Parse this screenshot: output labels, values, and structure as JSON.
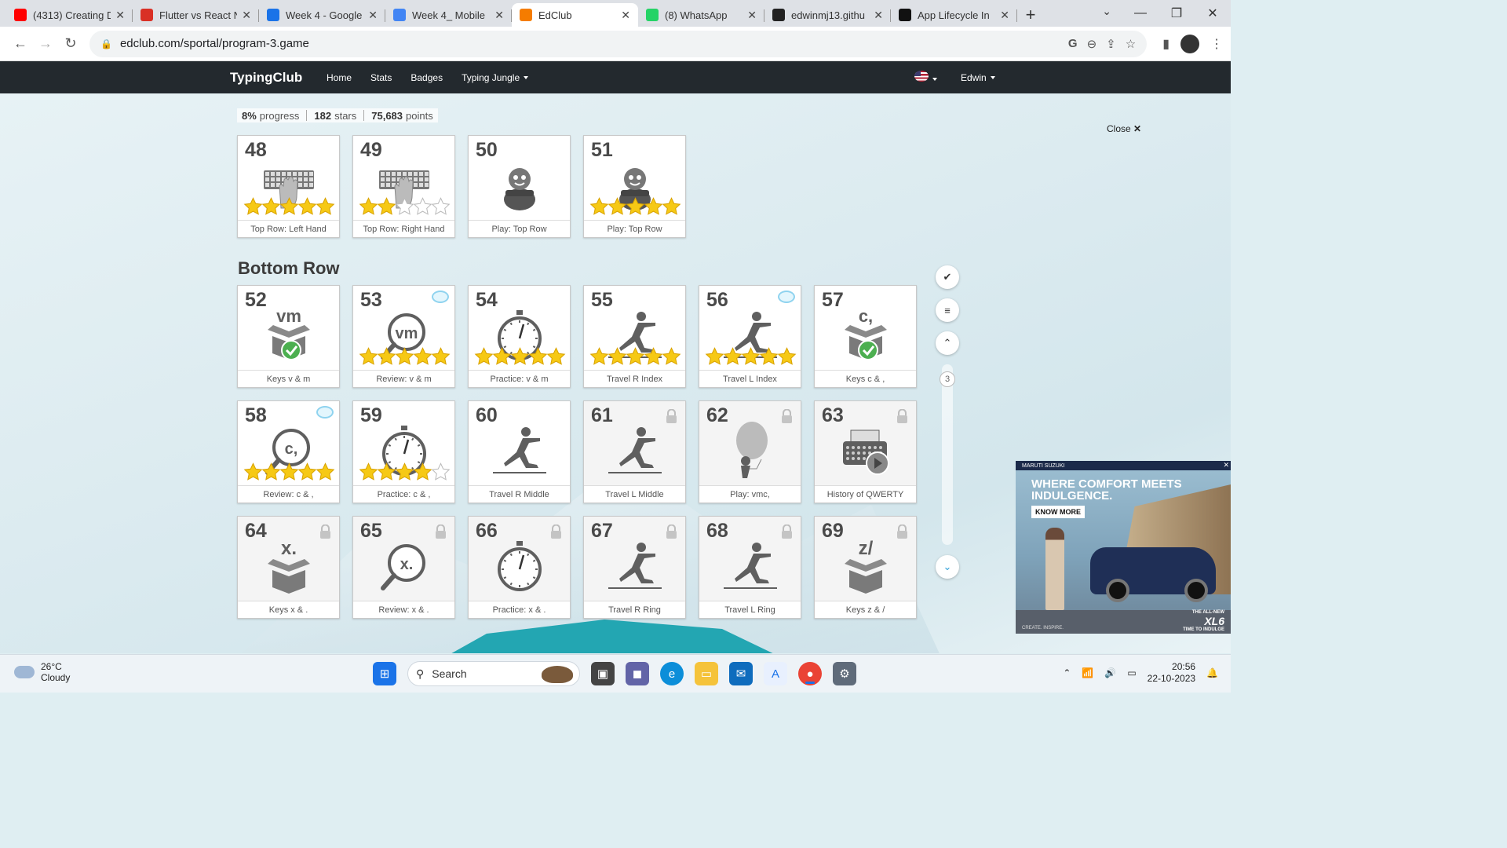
{
  "browser": {
    "tabs": [
      {
        "label": "(4313) Creating D",
        "icon": "youtube-icon",
        "color": "#ff0000",
        "active": false
      },
      {
        "label": "Flutter vs React N",
        "icon": "gmail-icon",
        "color": "#d93025",
        "active": false
      },
      {
        "label": "Week 4 - Google",
        "icon": "google-drive-icon",
        "color": "#1a73e8",
        "active": false
      },
      {
        "label": "Week 4_ Mobile",
        "icon": "google-docs-icon",
        "color": "#4285f4",
        "active": false
      },
      {
        "label": "EdClub",
        "icon": "edclub-icon",
        "color": "#f57c00",
        "active": true
      },
      {
        "label": "(8) WhatsApp",
        "icon": "whatsapp-icon",
        "color": "#25d366",
        "active": false
      },
      {
        "label": "edwinmj13.githu",
        "icon": "github-icon",
        "color": "#222222",
        "active": false
      },
      {
        "label": "App Lifecycle In",
        "icon": "medium-icon",
        "color": "#111111",
        "active": false
      }
    ],
    "url": "edclub.com/sportal/program-3.game"
  },
  "site": {
    "brand": "TypingClub",
    "nav": [
      "Home",
      "Stats",
      "Badges",
      "Typing Jungle"
    ],
    "user": "Edwin"
  },
  "progress": {
    "percent": "8%",
    "percent_label": "progress",
    "stars": "182",
    "stars_label": "stars",
    "points": "75,683",
    "points_label": "points"
  },
  "close_label": "Close",
  "section_title": "Bottom Row",
  "lessons_top": [
    {
      "num": "48",
      "label": "Top Row: Left Hand",
      "art": "keyboard-hand",
      "stars": 5,
      "locked": false,
      "badge": false
    },
    {
      "num": "49",
      "label": "Top Row: Right Hand",
      "art": "keyboard-hand",
      "stars": 2,
      "locked": false,
      "badge": false
    },
    {
      "num": "50",
      "label": "Play: Top Row",
      "art": "game",
      "stars": 0,
      "locked": false,
      "badge": false
    },
    {
      "num": "51",
      "label": "Play: Top Row",
      "art": "game",
      "stars": 5,
      "locked": false,
      "badge": false
    }
  ],
  "lessons_bottom": [
    {
      "num": "52",
      "label": "Keys v & m",
      "art": "box-check",
      "keys": "vm",
      "stars": 0,
      "locked": false,
      "badge": false
    },
    {
      "num": "53",
      "label": "Review: v & m",
      "art": "magnifier",
      "keys": "vm",
      "stars": 5,
      "locked": false,
      "badge": true
    },
    {
      "num": "54",
      "label": "Practice: v & m",
      "art": "stopwatch",
      "stars": 5,
      "locked": false,
      "badge": false
    },
    {
      "num": "55",
      "label": "Travel R Index",
      "art": "runner",
      "stars": 5,
      "locked": false,
      "badge": false
    },
    {
      "num": "56",
      "label": "Travel L Index",
      "art": "runner",
      "stars": 5,
      "locked": false,
      "badge": true
    },
    {
      "num": "57",
      "label": "Keys c & ,",
      "art": "box-check",
      "keys": "c,",
      "stars": 0,
      "locked": false,
      "badge": false
    },
    {
      "num": "58",
      "label": "Review: c & ,",
      "art": "magnifier",
      "keys": "c,",
      "stars": 5,
      "locked": false,
      "badge": true
    },
    {
      "num": "59",
      "label": "Practice: c & ,",
      "art": "stopwatch",
      "stars": 4,
      "locked": false,
      "badge": false
    },
    {
      "num": "60",
      "label": "Travel R Middle",
      "art": "runner",
      "stars": 0,
      "locked": false,
      "badge": false
    },
    {
      "num": "61",
      "label": "Travel L Middle",
      "art": "runner",
      "stars": 0,
      "locked": true,
      "badge": false
    },
    {
      "num": "62",
      "label": "Play: vmc,",
      "art": "balloon",
      "stars": 0,
      "locked": true,
      "badge": false
    },
    {
      "num": "63",
      "label": "History of QWERTY",
      "art": "typewriter",
      "stars": 0,
      "locked": true,
      "badge": false
    },
    {
      "num": "64",
      "label": "Keys x & .",
      "art": "box",
      "keys": "x.",
      "stars": 0,
      "locked": true,
      "badge": false
    },
    {
      "num": "65",
      "label": "Review: x & .",
      "art": "magnifier",
      "keys": "x.",
      "stars": 0,
      "locked": true,
      "badge": false
    },
    {
      "num": "66",
      "label": "Practice: x & .",
      "art": "stopwatch",
      "stars": 0,
      "locked": true,
      "badge": false
    },
    {
      "num": "67",
      "label": "Travel R Ring",
      "art": "runner",
      "stars": 0,
      "locked": true,
      "badge": false
    },
    {
      "num": "68",
      "label": "Travel L Ring",
      "art": "runner",
      "stars": 0,
      "locked": true,
      "badge": false
    },
    {
      "num": "69",
      "label": "Keys z & /",
      "art": "box",
      "keys": "z/",
      "stars": 0,
      "locked": true,
      "badge": false
    }
  ],
  "scroll_page": "3",
  "ad": {
    "brand": "MARUTI SUZUKI",
    "headline": "WHERE COMFORT MEETS INDULGENCE.",
    "cta": "KNOW MORE",
    "tagline": "CREATE. INSPIRE.",
    "model_sub": "THE ALL-NEW",
    "model": "XL6",
    "model_slogan": "TIME TO INDULGE"
  },
  "taskbar": {
    "temp": "26°C",
    "weather": "Cloudy",
    "search_placeholder": "Search",
    "time": "20:56",
    "date": "22-10-2023"
  }
}
